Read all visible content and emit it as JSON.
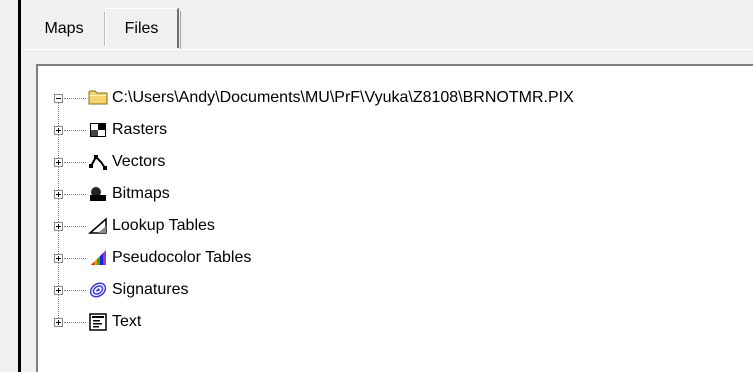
{
  "tabs": [
    {
      "label": "Maps",
      "active": false
    },
    {
      "label": "Files",
      "active": true
    }
  ],
  "tree": {
    "root": {
      "label": "C:\\Users\\Andy\\Documents\\MU\\PrF\\Vyuka\\Z8108\\BRNOTMR.PIX",
      "expanded": true,
      "icon": "folder-icon"
    },
    "children": [
      {
        "label": "Rasters",
        "icon": "rasters-icon",
        "expanded": false
      },
      {
        "label": "Vectors",
        "icon": "vectors-icon",
        "expanded": false
      },
      {
        "label": "Bitmaps",
        "icon": "bitmaps-icon",
        "expanded": false
      },
      {
        "label": "Lookup Tables",
        "icon": "lookup-tables-icon",
        "expanded": false
      },
      {
        "label": "Pseudocolor Tables",
        "icon": "pseudocolor-tables-icon",
        "expanded": false
      },
      {
        "label": "Signatures",
        "icon": "signatures-icon",
        "expanded": false
      },
      {
        "label": "Text",
        "icon": "text-icon",
        "expanded": false
      }
    ]
  },
  "colors": {
    "background": "#f0f0f0",
    "panel": "#ffffff",
    "folder": "#f4d46c",
    "signatures": "#3a3ad8"
  }
}
